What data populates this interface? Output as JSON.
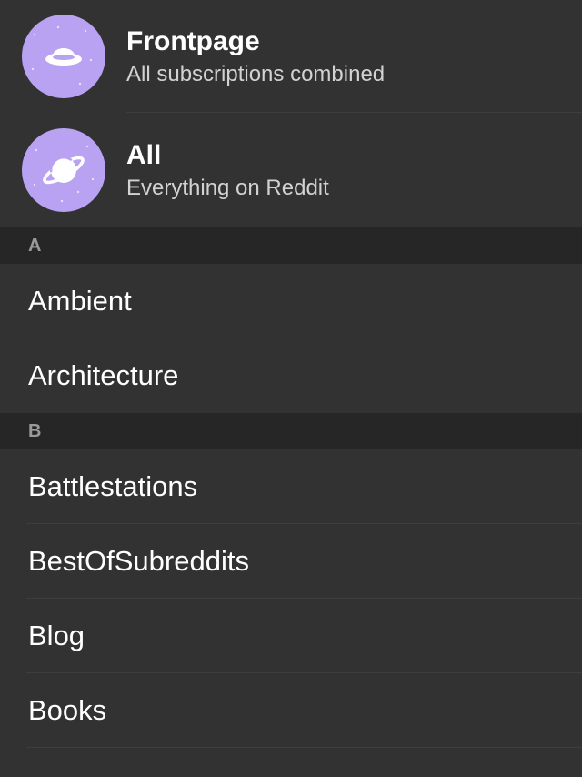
{
  "feeds": [
    {
      "title": "Frontpage",
      "subtitle": "All subscriptions combined",
      "icon": "frontpage-icon"
    },
    {
      "title": "All",
      "subtitle": "Everything on Reddit",
      "icon": "planet-icon"
    }
  ],
  "sections": [
    {
      "letter": "A",
      "items": [
        "Ambient",
        "Architecture"
      ]
    },
    {
      "letter": "B",
      "items": [
        "Battlestations",
        "BestOfSubreddits",
        "Blog",
        "Books"
      ]
    }
  ],
  "colors": {
    "background": "#323232",
    "section_background": "#262626",
    "avatar": "#b9a2f2",
    "text": "#ffffff",
    "subtitle": "#d2d2d2",
    "section_letter": "#9a9a9a"
  }
}
